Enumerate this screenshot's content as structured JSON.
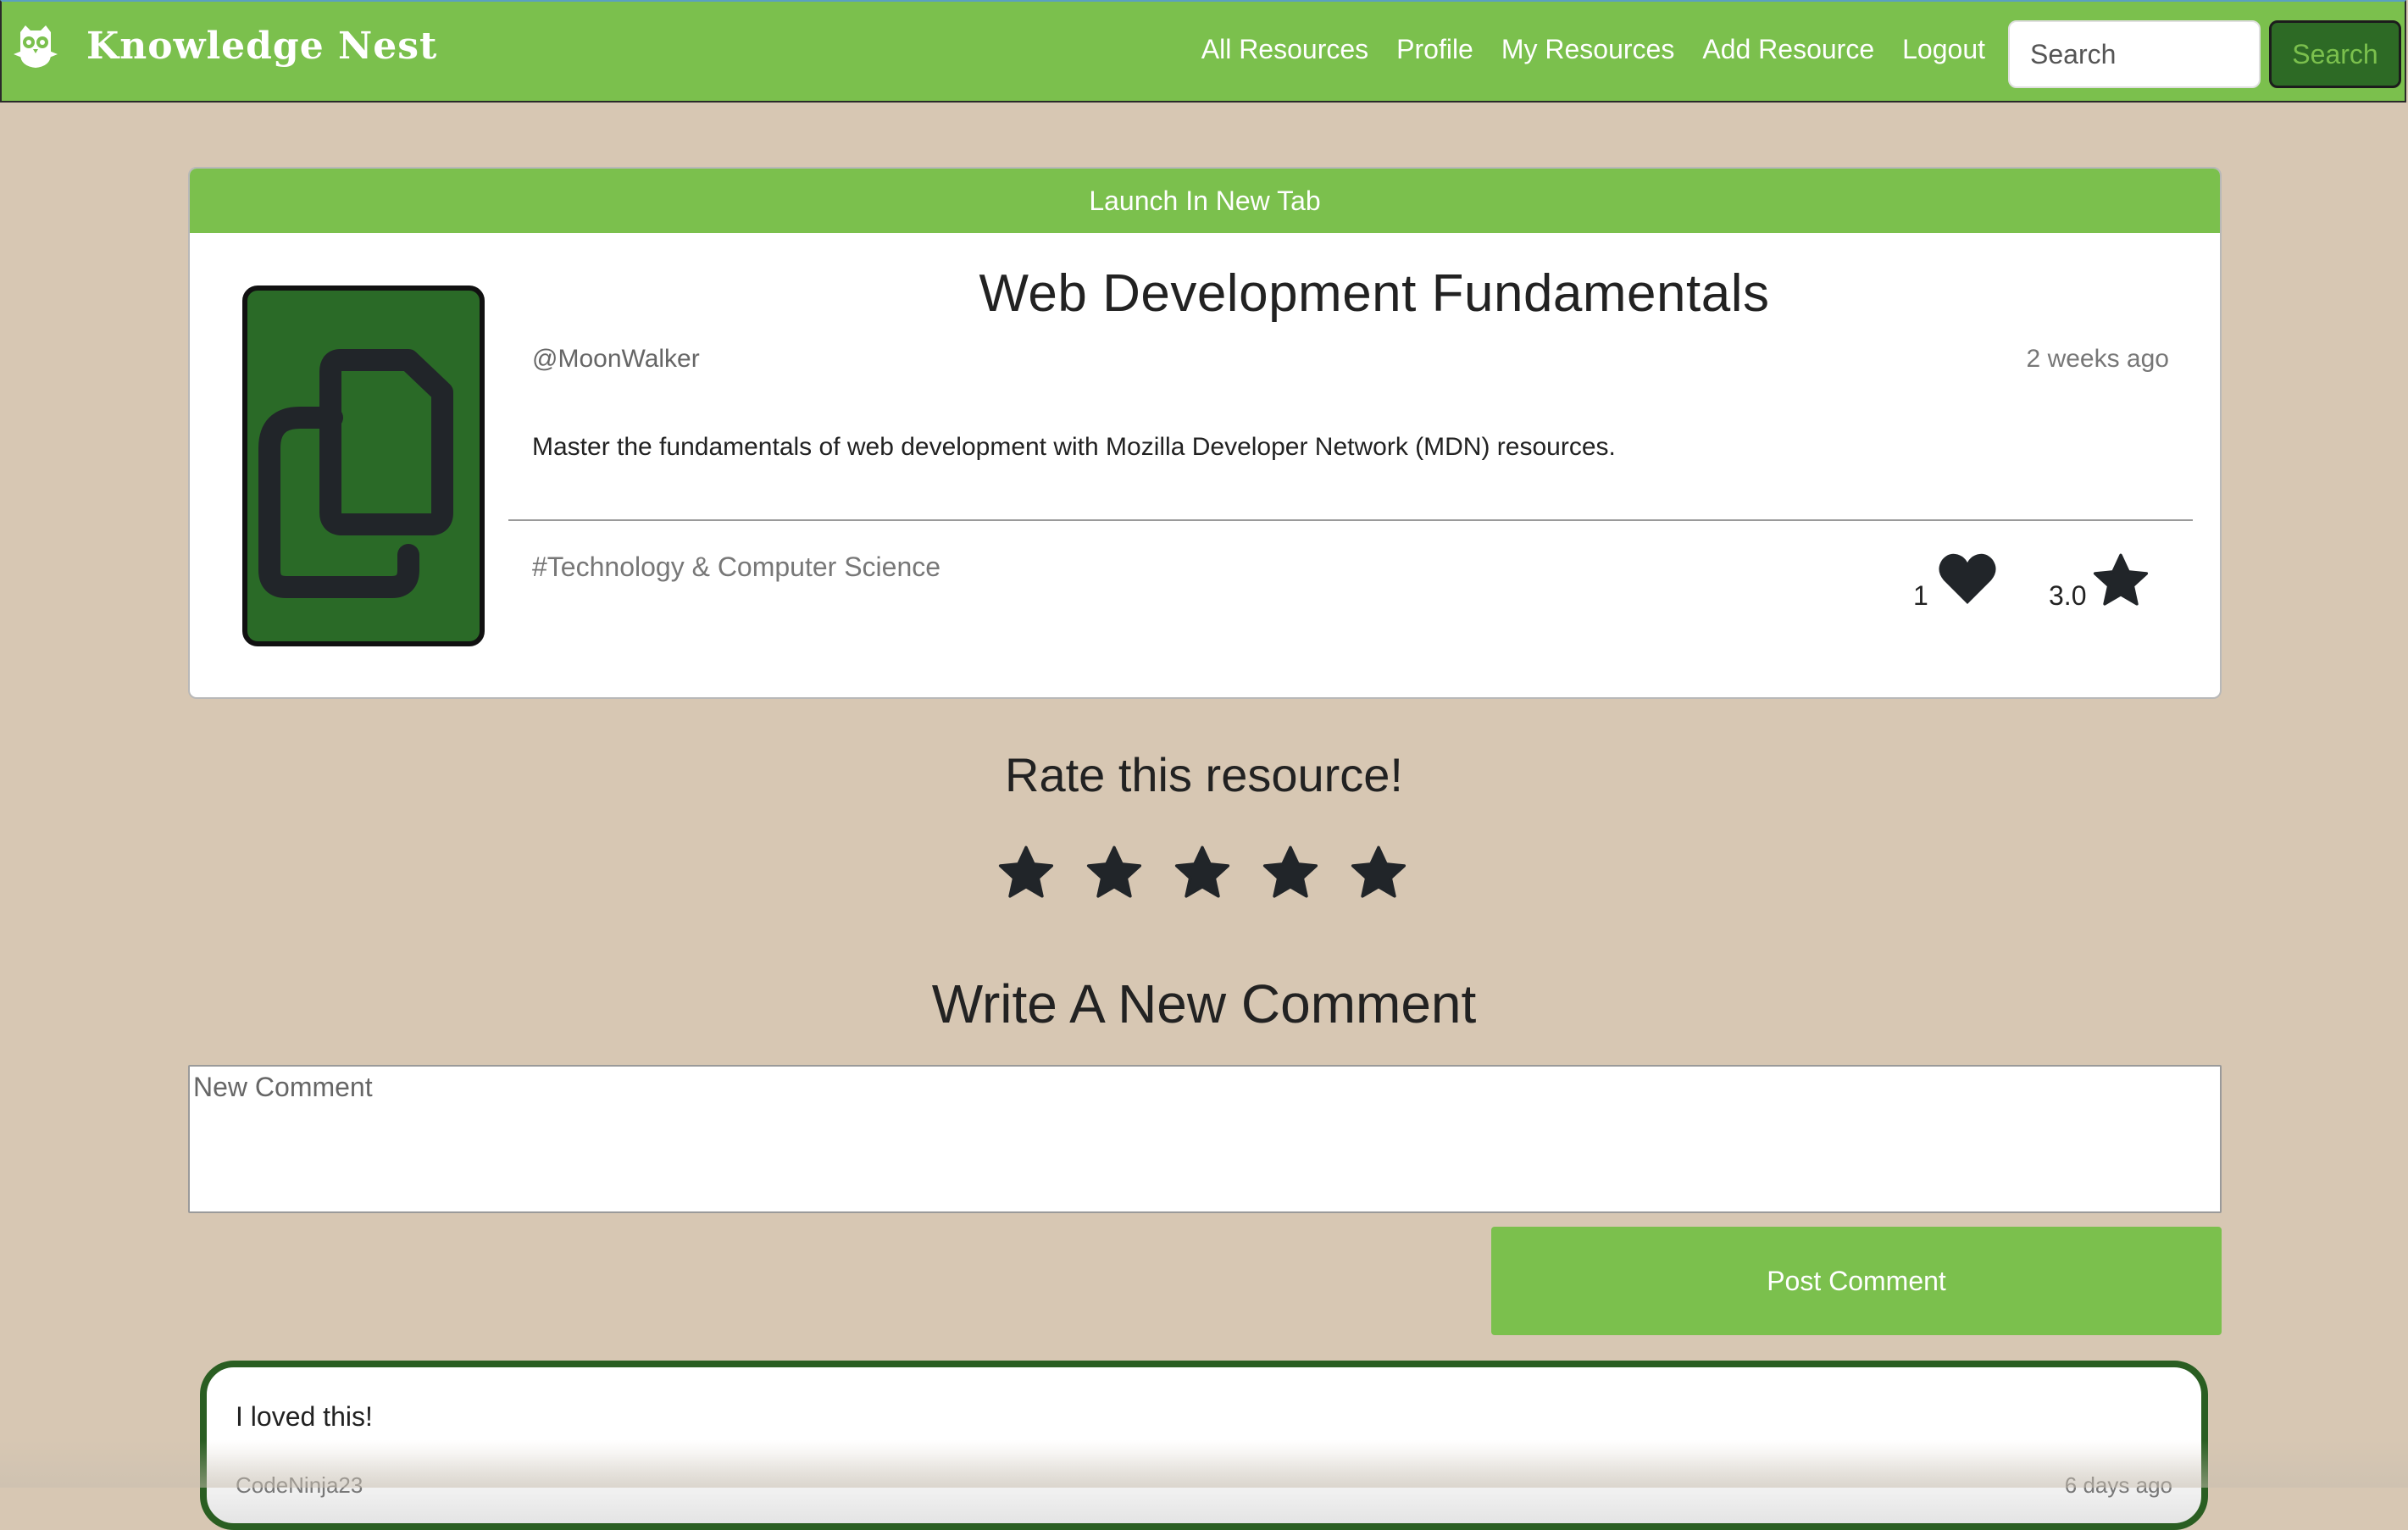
{
  "nav": {
    "brand": "Knowledge Nest",
    "brand_icon": "owl-logo-icon",
    "links": [
      "All Resources",
      "Profile",
      "My Resources",
      "Add Resource",
      "Logout"
    ],
    "search_placeholder": "Search",
    "search_button": "Search",
    "colors": {
      "primary": "#7bc04d",
      "dark_green": "#2d6a25",
      "background": "#d7c7b3"
    }
  },
  "resource": {
    "launch_label": "Launch In New Tab",
    "title": "Web Development Fundamentals",
    "author": "@MoonWalker",
    "time": "2 weeks ago",
    "description": "Master the fundamentals of web development with Mozilla Developer Network (MDN) resources.",
    "tag": "#Technology & Computer Science",
    "likes": "1",
    "rating": "3.0",
    "thumbnail_icon": "copy-documents-icon"
  },
  "rate": {
    "heading": "Rate this resource!",
    "stars": 5
  },
  "comment_form": {
    "heading": "Write A New Comment",
    "placeholder": "New Comment",
    "submit_label": "Post Comment"
  },
  "comments": [
    {
      "text": "I loved this!",
      "author": "CodeNinja23",
      "time": "6 days ago"
    }
  ]
}
